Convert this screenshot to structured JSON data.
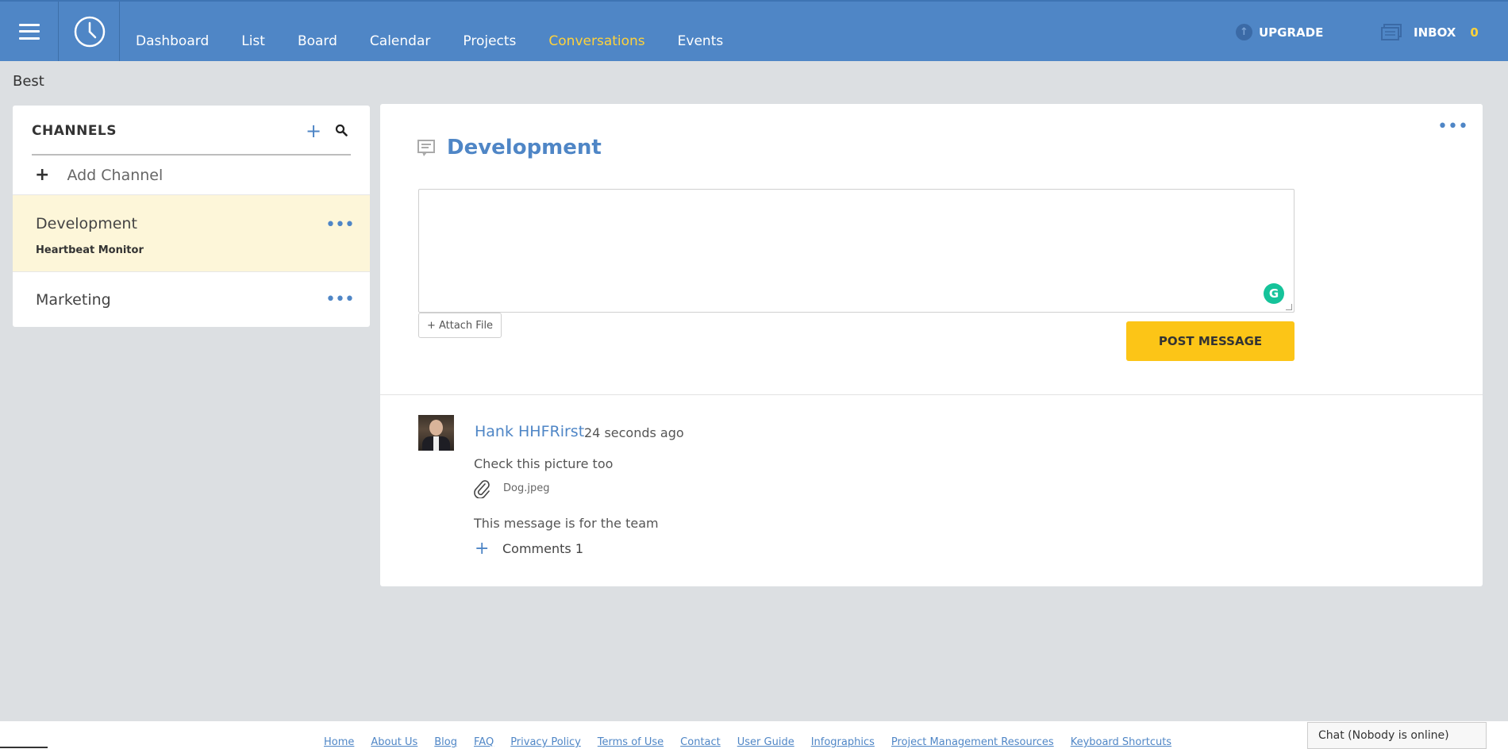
{
  "topbar": {
    "nav": [
      {
        "label": "Dashboard",
        "active": false
      },
      {
        "label": "List",
        "active": false
      },
      {
        "label": "Board",
        "active": false
      },
      {
        "label": "Calendar",
        "active": false
      },
      {
        "label": "Projects",
        "active": false
      },
      {
        "label": "Conversations",
        "active": true
      },
      {
        "label": "Events",
        "active": false
      }
    ],
    "upgrade_label": "UPGRADE",
    "inbox_label": "INBOX",
    "inbox_count": "0"
  },
  "page": {
    "label": "Best"
  },
  "channels": {
    "title": "CHANNELS",
    "add_label": "Add Channel",
    "items": [
      {
        "name": "Development",
        "subtitle": "Heartbeat Monitor",
        "active": true
      },
      {
        "name": "Marketing",
        "subtitle": "",
        "active": false
      }
    ]
  },
  "conversation": {
    "title": "Development",
    "message_placeholder": "",
    "attach_label": "+ Attach File",
    "post_label": "POST MESSAGE",
    "grammarly_glyph": "G",
    "messages": [
      {
        "author": "Hank HHFRirst",
        "time": "24 seconds ago",
        "text": "Check this picture too",
        "attachment": "Dog.jpeg",
        "text2": "This message is for the team",
        "comments_label": "Comments 1"
      }
    ]
  },
  "footer": {
    "links": [
      "Home",
      "About Us",
      "Blog",
      "FAQ",
      "Privacy Policy",
      "Terms of Use",
      "Contact",
      "User Guide",
      "Infographics",
      "Project Management Resources",
      "Keyboard Shortcuts"
    ],
    "chat_label": "Chat (Nobody is online)"
  },
  "colors": {
    "topbar": "#4f86c6",
    "accent_yellow": "#fcc517",
    "active_nav": "#ffd23a",
    "active_channel_bg": "#fdf6d9",
    "grammarly": "#15c39a"
  },
  "icons": [
    "hamburger-icon",
    "clock-icon",
    "upgrade-arrow-icon",
    "inbox-icon",
    "plus-icon",
    "search-icon",
    "more-icon",
    "conversation-icon",
    "grammarly-icon",
    "paperclip-icon"
  ]
}
